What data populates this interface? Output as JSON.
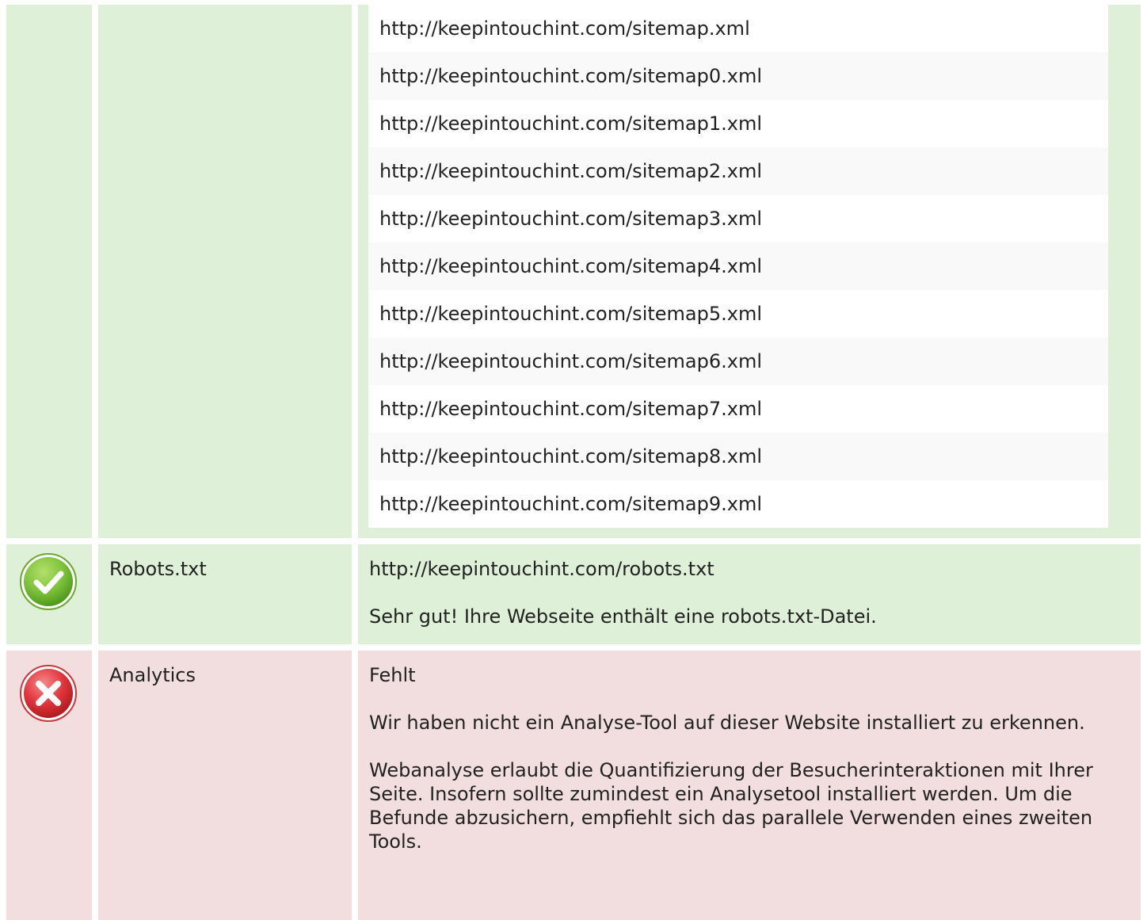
{
  "colors": {
    "pass_background": "#dff0d8",
    "fail_background": "#f2dede",
    "pass_icon": "#7dc13b",
    "fail_icon": "#e0333a"
  },
  "sitemaps": {
    "urls": [
      "http://keepintouchint.com/sitemap.xml",
      "http://keepintouchint.com/sitemap0.xml",
      "http://keepintouchint.com/sitemap1.xml",
      "http://keepintouchint.com/sitemap2.xml",
      "http://keepintouchint.com/sitemap3.xml",
      "http://keepintouchint.com/sitemap4.xml",
      "http://keepintouchint.com/sitemap5.xml",
      "http://keepintouchint.com/sitemap6.xml",
      "http://keepintouchint.com/sitemap7.xml",
      "http://keepintouchint.com/sitemap8.xml",
      "http://keepintouchint.com/sitemap9.xml"
    ]
  },
  "robots": {
    "status_icon": "check-circle-icon",
    "label": "Robots.txt",
    "url": "http://keepintouchint.com/robots.txt",
    "message": "Sehr gut! Ihre Webseite enthält eine robots.txt-Datei."
  },
  "analytics": {
    "status_icon": "x-circle-icon",
    "label": "Analytics",
    "status": "Fehlt",
    "message": "Wir haben nicht ein Analyse-Tool auf dieser Website installiert zu erkennen.",
    "advice": "Webanalyse erlaubt die Quantifizierung der Besucherinteraktionen mit Ihrer Seite. Insofern sollte zumindest ein Analysetool installiert werden. Um die Befunde abzusichern, empfiehlt sich das parallele Verwenden eines zweiten Tools."
  }
}
